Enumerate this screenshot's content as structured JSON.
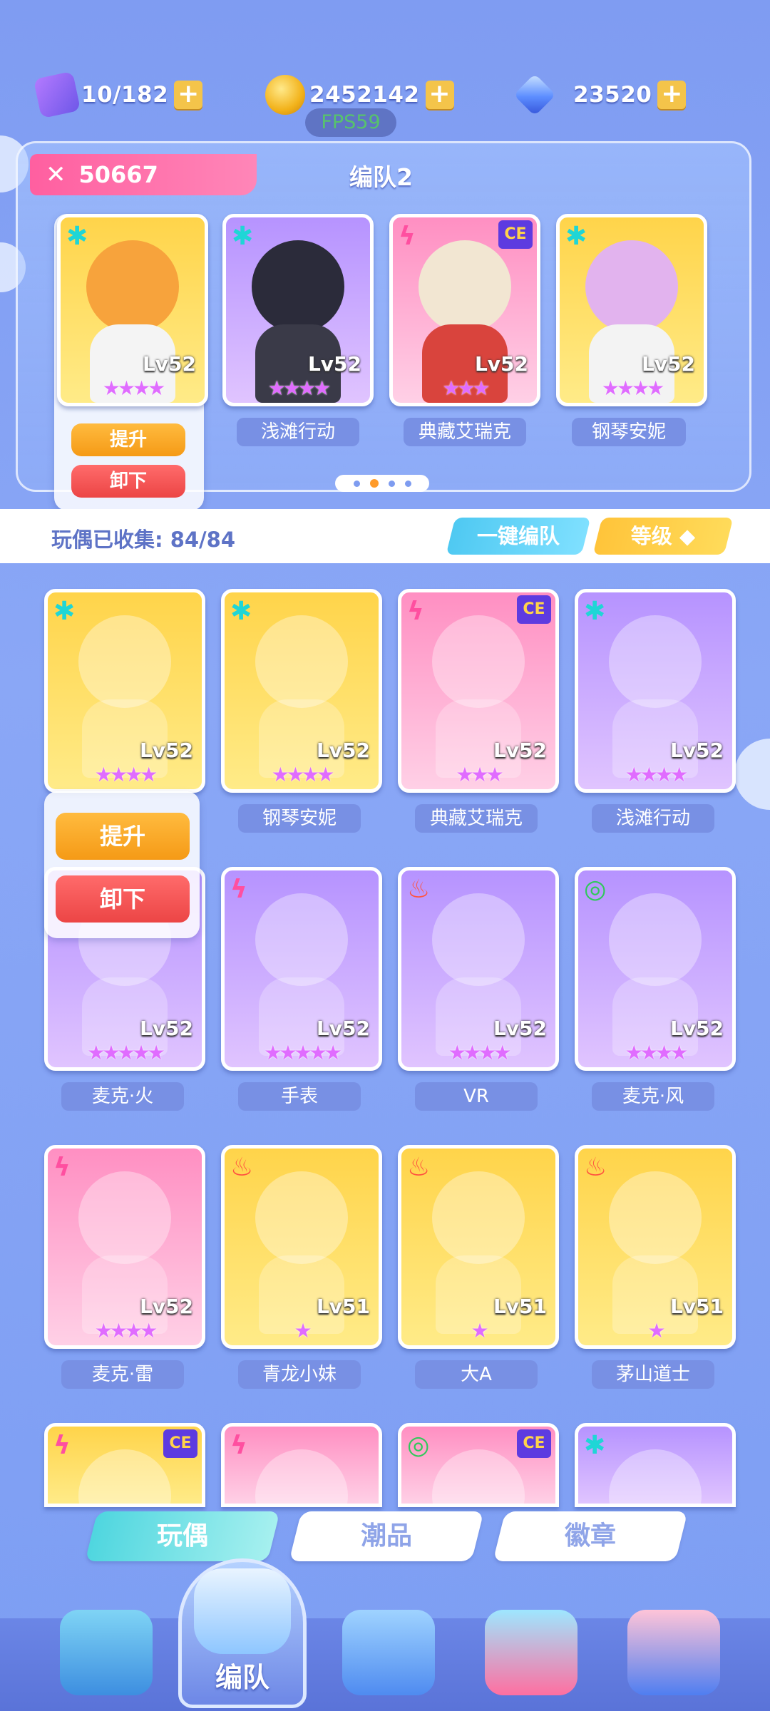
{
  "resources": {
    "energy": "10/182",
    "coins": "2452142",
    "gems": "23520",
    "fps": "FPS59"
  },
  "team": {
    "power": "50667",
    "name": "编队2",
    "slot1": {
      "level": "Lv52",
      "element": "✱",
      "stars": "★★★★"
    },
    "slot2": {
      "name": "浅滩行动",
      "level": "Lv52",
      "element": "✱",
      "stars": "★★★★"
    },
    "slot3": {
      "name": "典藏艾瑞克",
      "level": "Lv52",
      "element": "ϟ",
      "stars": "★★★",
      "badge": "CE"
    },
    "slot4": {
      "name": "钢琴安妮",
      "level": "Lv52",
      "element": "✱",
      "stars": "★★★★"
    },
    "popup": {
      "upgrade": "提升",
      "remove": "卸下"
    },
    "page_index": 2,
    "page_count": 4
  },
  "collection": {
    "label": "玩偶已收集: 84/84",
    "auto_team": "一键编队",
    "sort": "等级 ◆"
  },
  "grid_popup": {
    "upgrade": "提升",
    "remove": "卸下"
  },
  "dolls": [
    {
      "name": "",
      "level": "Lv52",
      "element": "✱",
      "stars": "★★★★",
      "bg": "y"
    },
    {
      "name": "钢琴安妮",
      "level": "Lv52",
      "element": "✱",
      "stars": "★★★★",
      "bg": "y"
    },
    {
      "name": "典藏艾瑞克",
      "level": "Lv52",
      "element": "ϟ",
      "stars": "★★★",
      "bg": "pk",
      "badge": "CE"
    },
    {
      "name": "浅滩行动",
      "level": "Lv52",
      "element": "✱",
      "stars": "★★★★",
      "bg": "p"
    },
    {
      "name": "麦克·火",
      "level": "Lv52",
      "element": "",
      "stars": "★★★★★",
      "bg": "p"
    },
    {
      "name": "手表",
      "level": "Lv52",
      "element": "ϟ",
      "stars": "★★★★★",
      "bg": "p"
    },
    {
      "name": "VR",
      "level": "Lv52",
      "element": "♨",
      "stars": "★★★★",
      "bg": "p"
    },
    {
      "name": "麦克·风",
      "level": "Lv52",
      "element": "◎",
      "stars": "★★★★",
      "bg": "p"
    },
    {
      "name": "麦克·雷",
      "level": "Lv52",
      "element": "ϟ",
      "stars": "★★★★",
      "bg": "pk"
    },
    {
      "name": "青龙小妹",
      "level": "Lv51",
      "element": "♨",
      "stars": "★",
      "bg": "y"
    },
    {
      "name": "大A",
      "level": "Lv51",
      "element": "♨",
      "stars": "★",
      "bg": "y"
    },
    {
      "name": "茅山道士",
      "level": "Lv51",
      "element": "♨",
      "stars": "★",
      "bg": "y"
    },
    {
      "name": "",
      "level": "",
      "element": "ϟ",
      "stars": "",
      "bg": "y",
      "badge": "CE"
    },
    {
      "name": "",
      "level": "",
      "element": "ϟ",
      "stars": "",
      "bg": "pk"
    },
    {
      "name": "",
      "level": "",
      "element": "◎",
      "stars": "",
      "bg": "pk",
      "badge": "CE"
    },
    {
      "name": "",
      "level": "",
      "element": "✱",
      "stars": "",
      "bg": "p"
    }
  ],
  "tabs": [
    "玩偶",
    "潮品",
    "徽章"
  ],
  "nav": {
    "active_label": "编队"
  },
  "colors": {
    "accent_cyan": "#4fd6df",
    "accent_orange": "#ffbb3f",
    "danger_red": "#ec4545",
    "bg_blue": "#8aa7f6"
  }
}
